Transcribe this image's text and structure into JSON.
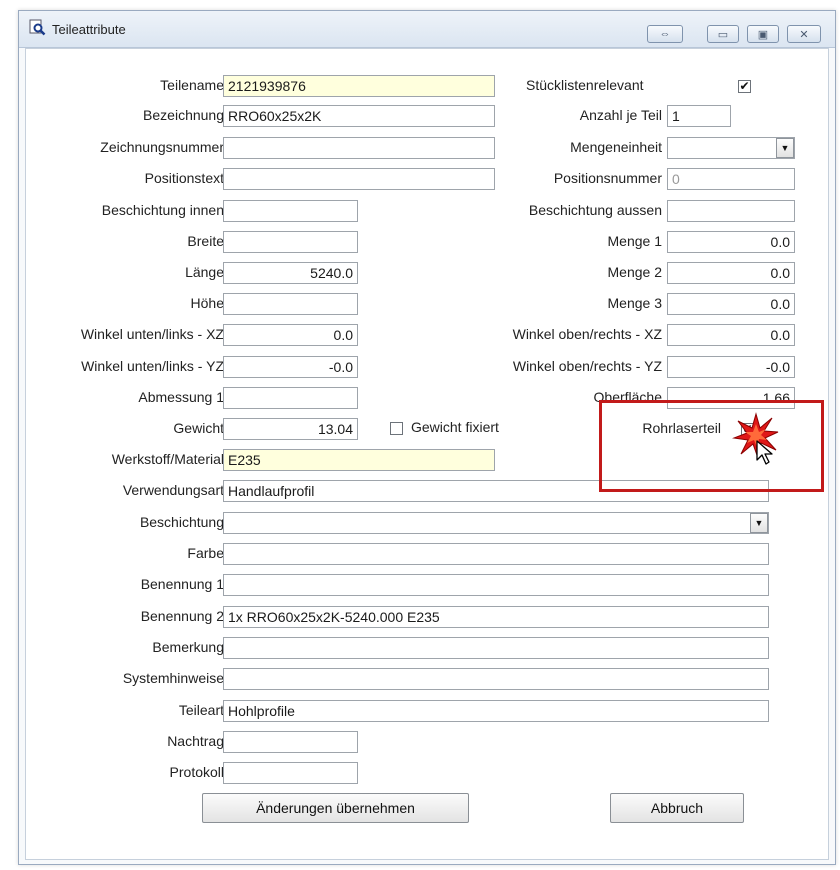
{
  "window": {
    "title": "Teileattribute",
    "icon": "search-document-icon"
  },
  "title_buttons": {
    "restore_icon": "swap-icon",
    "minimize_icon": "minimize-icon",
    "maximize_icon": "maximize-icon",
    "close_icon": "close-icon"
  },
  "left": {
    "teilename": {
      "label": "Teilename",
      "value": "2121939876"
    },
    "bezeichnung": {
      "label": "Bezeichnung",
      "value": "RRO60x25x2K"
    },
    "zeichnungsnummer": {
      "label": "Zeichnungsnummer",
      "value": ""
    },
    "positionstext": {
      "label": "Positionstext",
      "value": ""
    },
    "beschichtung_innen": {
      "label": "Beschichtung innen",
      "value": ""
    },
    "breite": {
      "label": "Breite",
      "value": ""
    },
    "laenge": {
      "label": "Länge",
      "value": "5240.0"
    },
    "hoehe": {
      "label": "Höhe",
      "value": ""
    },
    "winkel_ul_xz": {
      "label": "Winkel unten/links - XZ",
      "value": "0.0"
    },
    "winkel_ul_yz": {
      "label": "Winkel unten/links - YZ",
      "value": "-0.0"
    },
    "abmessung1": {
      "label": "Abmessung 1",
      "value": ""
    },
    "gewicht": {
      "label": "Gewicht",
      "value": "13.04"
    },
    "werkstoff": {
      "label": "Werkstoff/Material",
      "value": "E235"
    },
    "verwendungsart": {
      "label": "Verwendungsart",
      "value": "Handlaufprofil"
    },
    "beschichtung": {
      "label": "Beschichtung",
      "value": ""
    },
    "farbe": {
      "label": "Farbe",
      "value": ""
    },
    "benennung1": {
      "label": "Benennung 1",
      "value": ""
    },
    "benennung2": {
      "label": "Benennung 2",
      "value": "1x RRO60x25x2K-5240.000 E235"
    },
    "bemerkung": {
      "label": "Bemerkung",
      "value": ""
    },
    "systemhinweise": {
      "label": "Systemhinweise",
      "value": ""
    },
    "teileart": {
      "label": "Teileart",
      "value": "Hohlprofile"
    },
    "nachtrag": {
      "label": "Nachtrag",
      "value": ""
    },
    "protokoll": {
      "label": "Protokoll",
      "value": ""
    }
  },
  "right": {
    "stuecklistenrelevant": {
      "label": "Stücklistenrelevant",
      "checked": true
    },
    "anzahl": {
      "label": "Anzahl je Teil",
      "value": "1"
    },
    "mengeneinheit": {
      "label": "Mengeneinheit",
      "value": ""
    },
    "positionsnummer": {
      "label": "Positionsnummer",
      "value": "0"
    },
    "beschichtung_aussen": {
      "label": "Beschichtung aussen",
      "value": ""
    },
    "menge1": {
      "label": "Menge 1",
      "value": "0.0"
    },
    "menge2": {
      "label": "Menge 2",
      "value": "0.0"
    },
    "menge3": {
      "label": "Menge 3",
      "value": "0.0"
    },
    "winkel_or_xz": {
      "label": "Winkel oben/rechts - XZ",
      "value": "0.0"
    },
    "winkel_or_yz": {
      "label": "Winkel oben/rechts - YZ",
      "value": "-0.0"
    },
    "oberflaeche": {
      "label": "Oberfläche",
      "value": "1.66"
    },
    "rohrlaserteil": {
      "label": "Rohrlaserteil",
      "checked": true
    }
  },
  "gewicht_fixiert": {
    "label": "Gewicht fixiert",
    "checked": false
  },
  "buttons": {
    "apply": "Änderungen übernehmen",
    "cancel": "Abbruch"
  },
  "colors": {
    "highlight": "#c21a1a",
    "required_field": "#ffffdd"
  }
}
